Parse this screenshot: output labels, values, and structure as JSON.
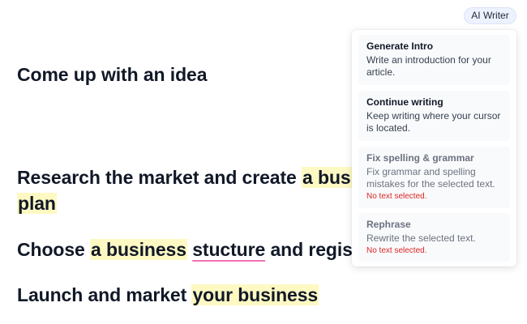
{
  "editor": {
    "heading1": "Come up with an idea",
    "heading2": {
      "plain": "Research the market and create ",
      "highlight": "a busi",
      "line2": "plan"
    },
    "heading3": {
      "plain": "Choose ",
      "highlight": "a business",
      "space": " ",
      "misspelled": "stucture",
      "rest": " and regist"
    },
    "heading4": {
      "plain": "Launch and market ",
      "highlight": "your business"
    }
  },
  "toolbar": {
    "ai_writer_label": "AI Writer"
  },
  "menu": {
    "items": [
      {
        "title": "Generate Intro",
        "description": "Write an introduction for your article."
      },
      {
        "title": "Continue writing",
        "description": "Keep writing where your cursor is located."
      },
      {
        "title": "Fix spelling & grammar",
        "description": "Fix grammar and spelling mistakes for the selected text.",
        "error": "No text selected."
      },
      {
        "title": "Rephrase",
        "description": "Rewrite the selected text.",
        "error": "No text selected."
      }
    ]
  },
  "colors": {
    "highlight": "#fef9c3",
    "spelling_underline": "#f472b6",
    "error_text": "#dc2626",
    "button_bg": "#eef2ff"
  }
}
